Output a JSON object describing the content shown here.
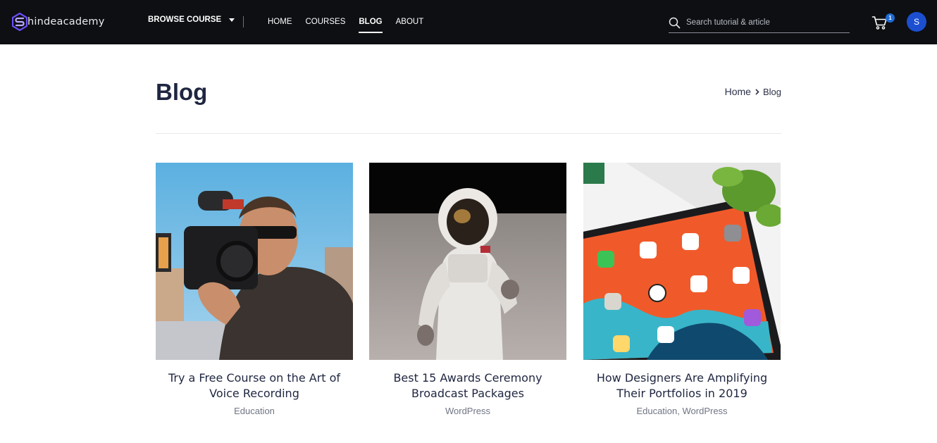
{
  "brand": {
    "name": "hindeacademy",
    "accent": "#7b5cff"
  },
  "nav": {
    "browse_label": "BROWSE COURSE",
    "links": [
      "HOME",
      "COURSES",
      "BLOG",
      "ABOUT"
    ],
    "active": "BLOG"
  },
  "search": {
    "placeholder": "Search tutorial & article",
    "value": ""
  },
  "cart": {
    "count": "1"
  },
  "user": {
    "initial": "S"
  },
  "page": {
    "title": "Blog",
    "breadcrumb": {
      "home": "Home",
      "current": "Blog"
    }
  },
  "posts": [
    {
      "title": "Try a Free Course on the Art of Voice Recording",
      "categories": [
        "Education"
      ],
      "image": "videographer-photo"
    },
    {
      "title": "Best 15 Awards Ceremony Broadcast Packages",
      "categories": [
        "WordPress"
      ],
      "image": "astronaut-photo"
    },
    {
      "title": "How Designers Are Amplifying Their Portfolios in 2019",
      "categories": [
        "Education",
        "WordPress"
      ],
      "image": "tablet-photo"
    }
  ],
  "colors": {
    "topbar": "#0d0f12",
    "heading": "#1f2640",
    "badge": "#1f6bd6",
    "avatar": "#1c4fd0"
  }
}
